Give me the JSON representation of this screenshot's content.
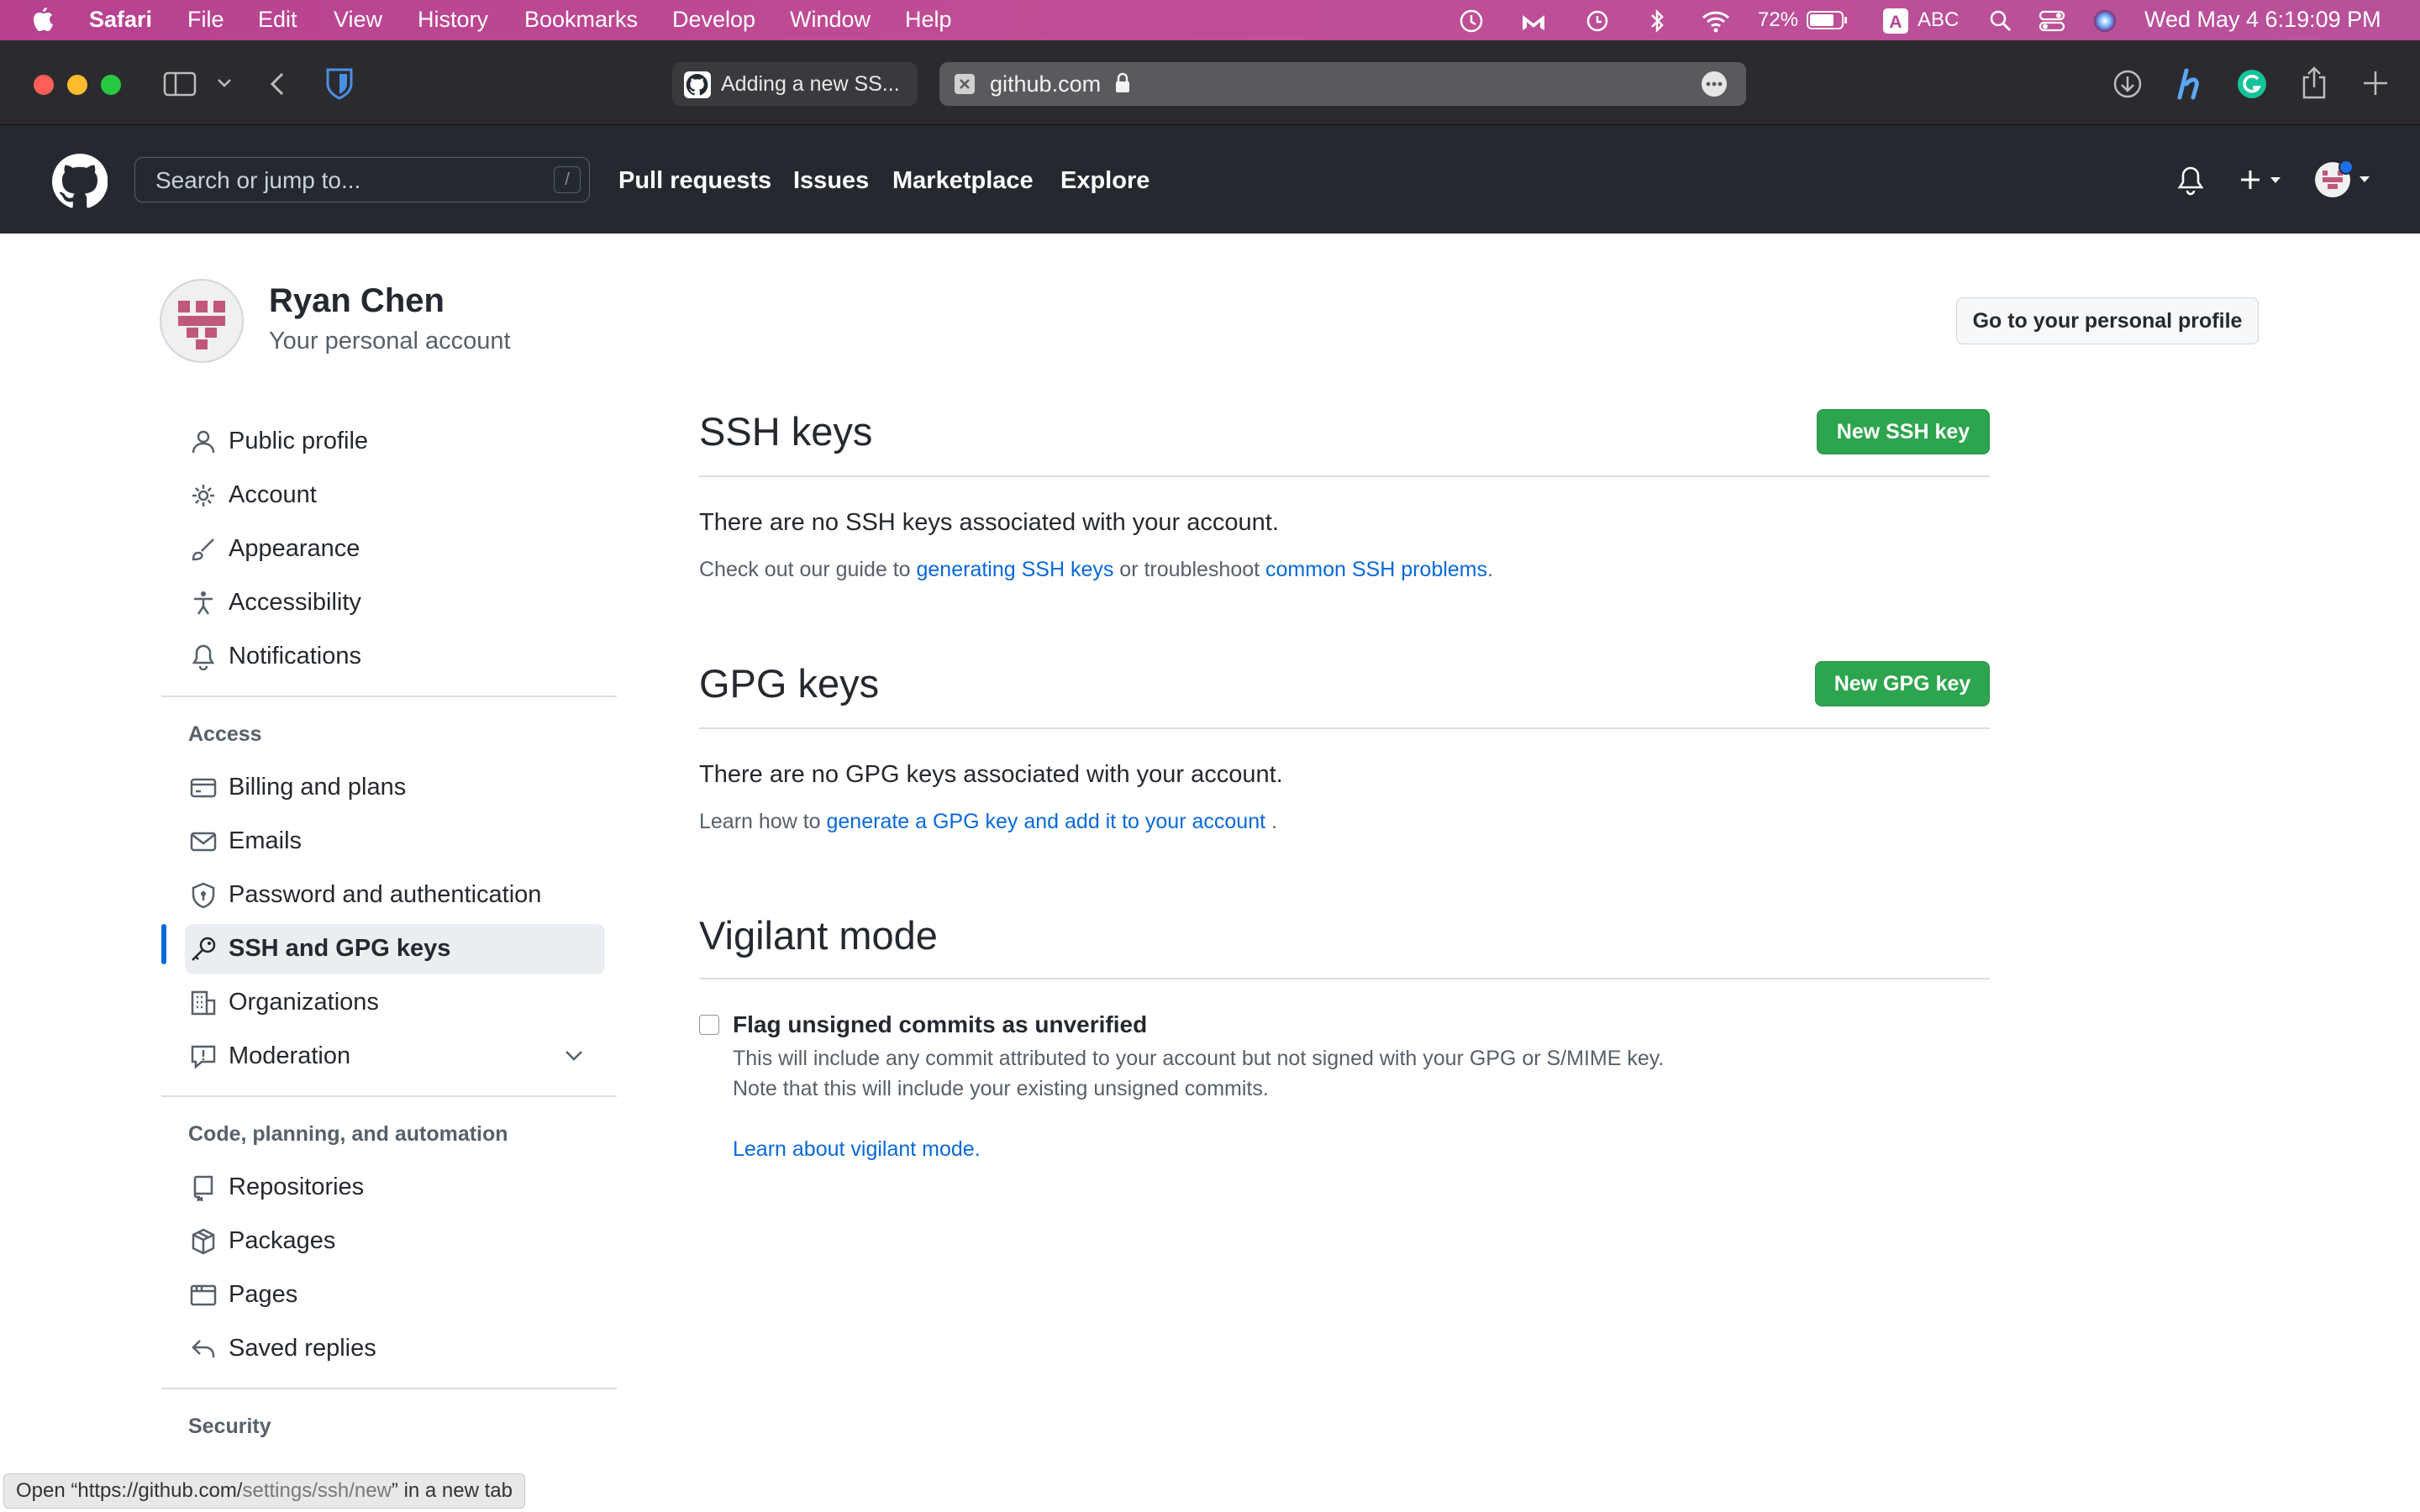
{
  "menubar": {
    "app_name": "Safari",
    "items": [
      "File",
      "Edit",
      "View",
      "History",
      "Bookmarks",
      "Develop",
      "Window",
      "Help"
    ],
    "battery": "72%",
    "input_source": "ABC",
    "clock": "Wed May 4  6:19:09 PM"
  },
  "browser": {
    "tab1_title": "Adding a new SS...",
    "address": "github.com"
  },
  "gh_header": {
    "search_placeholder": "Search or jump to...",
    "search_shortcut": "/",
    "nav": [
      "Pull requests",
      "Issues",
      "Marketplace",
      "Explore"
    ]
  },
  "profile": {
    "name": "Ryan Chen",
    "subtitle": "Your personal account",
    "profile_button": "Go to your personal profile"
  },
  "sidebar": {
    "top_items": [
      {
        "label": "Public profile",
        "icon": "person-icon"
      },
      {
        "label": "Account",
        "icon": "gear-icon"
      },
      {
        "label": "Appearance",
        "icon": "paintbrush-icon"
      },
      {
        "label": "Accessibility",
        "icon": "accessibility-icon"
      },
      {
        "label": "Notifications",
        "icon": "bell-icon"
      }
    ],
    "access_heading": "Access",
    "access_items": [
      {
        "label": "Billing and plans",
        "icon": "credit-card-icon"
      },
      {
        "label": "Emails",
        "icon": "mail-icon"
      },
      {
        "label": "Password and authentication",
        "icon": "shield-lock-icon"
      },
      {
        "label": "SSH and GPG keys",
        "icon": "key-icon",
        "selected": true
      },
      {
        "label": "Organizations",
        "icon": "organization-icon"
      },
      {
        "label": "Moderation",
        "icon": "report-icon"
      }
    ],
    "code_heading": "Code, planning, and automation",
    "code_items": [
      {
        "label": "Repositories",
        "icon": "repo-icon"
      },
      {
        "label": "Packages",
        "icon": "package-icon"
      },
      {
        "label": "Pages",
        "icon": "browser-icon"
      },
      {
        "label": "Saved replies",
        "icon": "reply-icon"
      }
    ],
    "security_heading": "Security"
  },
  "ssh": {
    "title": "SSH keys",
    "button": "New SSH key",
    "empty": "There are no SSH keys associated with your account.",
    "guide_prefix": "Check out our guide to ",
    "guide_link1": "generating SSH keys",
    "guide_middle": " or troubleshoot ",
    "guide_link2": "common SSH problems",
    "guide_suffix": "."
  },
  "gpg": {
    "title": "GPG keys",
    "button": "New GPG key",
    "empty": "There are no GPG keys associated with your account.",
    "learn_prefix": "Learn how to ",
    "learn_link": "generate a GPG key and add it to your account",
    "learn_suffix": " ."
  },
  "vigilant": {
    "title": "Vigilant mode",
    "checkbox_label": "Flag unsigned commits as unverified",
    "checked": false,
    "desc1": "This will include any commit attributed to your account but not signed with your GPG or S/MIME key.",
    "desc2": "Note that this will include your existing unsigned commits.",
    "learn_link": "Learn about vigilant mode."
  },
  "status_bar": {
    "prefix": "Open “https://github.com/",
    "path": "settings/ssh/new",
    "suffix": "” in a new tab"
  },
  "colors": {
    "menubar": "#b7418f",
    "github_header": "#24292f",
    "primary_button": "#2da44e",
    "link": "#0969da",
    "selected_indicator": "#0969da",
    "avatar_pink": "#c0587a"
  }
}
